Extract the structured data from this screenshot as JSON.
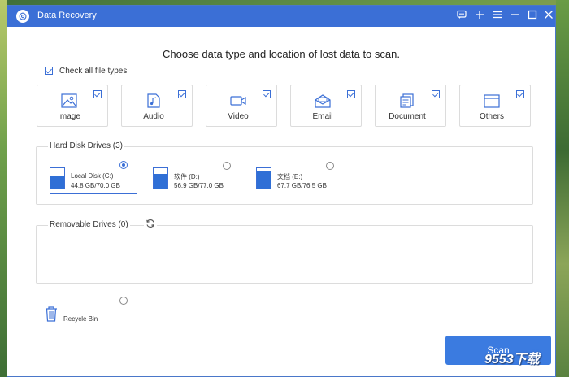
{
  "window": {
    "title": "Data Recovery",
    "controls": [
      "feedback-icon",
      "plus-icon",
      "menu-icon",
      "minimize-icon",
      "maximize-icon",
      "close-icon"
    ]
  },
  "heading": "Choose data type and location of lost data to scan.",
  "check_all_label": "Check all file types",
  "file_types": [
    {
      "label": "Image",
      "icon": "image-icon",
      "checked": true
    },
    {
      "label": "Audio",
      "icon": "audio-icon",
      "checked": true
    },
    {
      "label": "Video",
      "icon": "video-icon",
      "checked": true
    },
    {
      "label": "Email",
      "icon": "email-icon",
      "checked": true
    },
    {
      "label": "Document",
      "icon": "document-icon",
      "checked": true
    },
    {
      "label": "Others",
      "icon": "folder-icon",
      "checked": true
    }
  ],
  "hard_disk": {
    "title": "Hard Disk Drives (3)",
    "drives": [
      {
        "name": "Local Disk (C:)",
        "size": "44.8 GB/70.0 GB",
        "used_fraction": 0.64,
        "selected": true
      },
      {
        "name": "软件 (D:)",
        "size": "56.9 GB/77.0 GB",
        "used_fraction": 0.74,
        "selected": false
      },
      {
        "name": "文档 (E:)",
        "size": "67.7 GB/76.5 GB",
        "used_fraction": 0.88,
        "selected": false
      }
    ]
  },
  "removable": {
    "title": "Removable Drives (0)"
  },
  "recycle_bin_label": "Recycle Bin",
  "scan_label": "Scan",
  "watermark": "9553下载",
  "colors": {
    "accent": "#3b6fd6",
    "button": "#3b7be0"
  }
}
